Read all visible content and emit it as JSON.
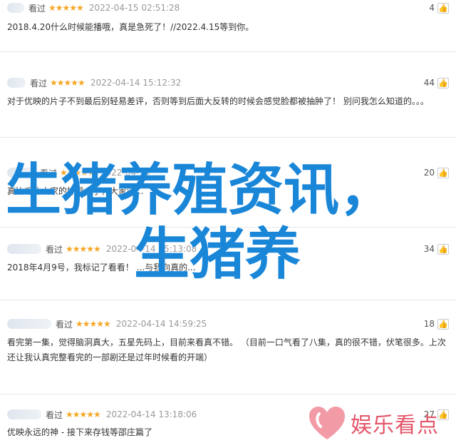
{
  "reviews": [
    {
      "rating_word": "看过",
      "stars": "★★★★★",
      "date": "2022-04-15 02:51:28",
      "helpful": "4",
      "text": "2018.4.20什么时候能播哦，真是急死了！//2022.4.15等到你。"
    },
    {
      "rating_word": "看过",
      "stars": "★★★★★",
      "date": "2022-04-14 15:12:32",
      "helpful": "44",
      "text": "对于优映的片子不到最后别轻易差评，否则等到后面大反转的时候会感觉脸都被抽肿了！ 别问我怎么知道的。。。"
    },
    {
      "rating_word": "看过",
      "stars": "★★★★★",
      "date": "2022-04-14",
      "helpful": "20",
      "text": "真比毛片大家的好看多了，大家的..."
    },
    {
      "rating_word": "看过",
      "stars": "★★★★★",
      "date": "2022-04-14 15:13:08",
      "helpful": "34",
      "text": "2018年4月9号，我标记了看看！ ...与我向真的..."
    },
    {
      "rating_word": "看过",
      "stars": "★★★★★",
      "date": "2022-04-14 14:59:25",
      "helpful": "18",
      "text": "看完第一集，觉得脑洞真大，五星先码上，目前来看真不错。 （目前一口气看了八集，真的很不错，伏笔很多。上次还让我认真完整看完的一部剧还是过年时候看的开端）"
    },
    {
      "rating_word": "看过",
      "stars": "★★★★★",
      "date": "2022-04-14 13:18:06",
      "helpful": "27",
      "text": "优映永远的神 - 接下来存钱等邵庄篇了"
    }
  ],
  "overlay": {
    "line1": "生猪养殖资讯，",
    "line2": "生猪养"
  },
  "watermark": {
    "text": "娱乐看点"
  },
  "colors": {
    "star": "#f5a623",
    "overlay": "#1a86d8",
    "watermark": "#e5566a"
  }
}
